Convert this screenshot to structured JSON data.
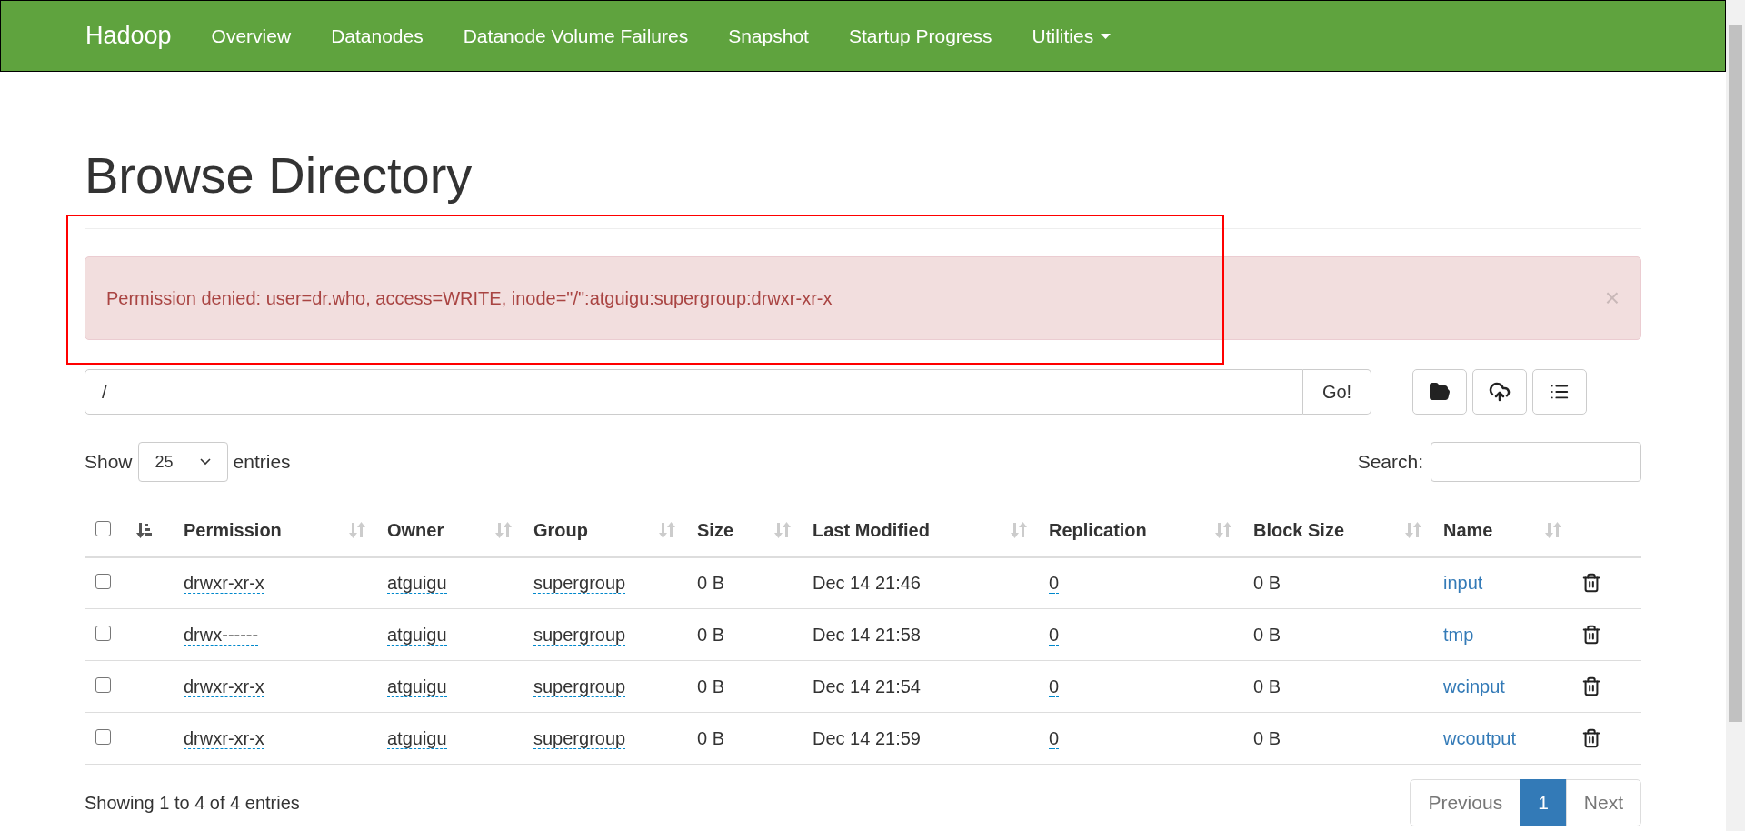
{
  "navbar": {
    "brand": "Hadoop",
    "items": [
      {
        "label": "Overview",
        "dropdown": false
      },
      {
        "label": "Datanodes",
        "dropdown": false
      },
      {
        "label": "Datanode Volume Failures",
        "dropdown": false
      },
      {
        "label": "Snapshot",
        "dropdown": false
      },
      {
        "label": "Startup Progress",
        "dropdown": false
      },
      {
        "label": "Utilities",
        "dropdown": true
      }
    ]
  },
  "title": "Browse Directory",
  "alert": {
    "message": "Permission denied: user=dr.who, access=WRITE, inode=\"/\":atguigu:supergroup:drwxr-xr-x",
    "close": "×"
  },
  "path_bar": {
    "value": "/",
    "go_button": "Go!"
  },
  "length_control": {
    "label_before": "Show",
    "value": "25",
    "label_after": "entries"
  },
  "search": {
    "label": "Search:"
  },
  "table": {
    "select_all": {
      "checked": false
    },
    "columns": [
      "Permission",
      "Owner",
      "Group",
      "Size",
      "Last Modified",
      "Replication",
      "Block Size",
      "Name"
    ],
    "rows": [
      {
        "checked": false,
        "permission": "drwxr-xr-x",
        "owner": "atguigu",
        "group": "supergroup",
        "size": "0 B",
        "last_modified": "Dec 14 21:46",
        "replication": "0",
        "block_size": "0 B",
        "name": "input"
      },
      {
        "checked": false,
        "permission": "drwx------",
        "owner": "atguigu",
        "group": "supergroup",
        "size": "0 B",
        "last_modified": "Dec 14 21:58",
        "replication": "0",
        "block_size": "0 B",
        "name": "tmp"
      },
      {
        "checked": false,
        "permission": "drwxr-xr-x",
        "owner": "atguigu",
        "group": "supergroup",
        "size": "0 B",
        "last_modified": "Dec 14 21:54",
        "replication": "0",
        "block_size": "0 B",
        "name": "wcinput"
      },
      {
        "checked": false,
        "permission": "drwxr-xr-x",
        "owner": "atguigu",
        "group": "supergroup",
        "size": "0 B",
        "last_modified": "Dec 14 21:59",
        "replication": "0",
        "block_size": "0 B",
        "name": "wcoutput"
      }
    ]
  },
  "info": "Showing 1 to 4 of 4 entries",
  "pagination": [
    {
      "label": "Previous",
      "selected": false
    },
    {
      "label": "1",
      "selected": true
    },
    {
      "label": "Next",
      "selected": false
    }
  ]
}
